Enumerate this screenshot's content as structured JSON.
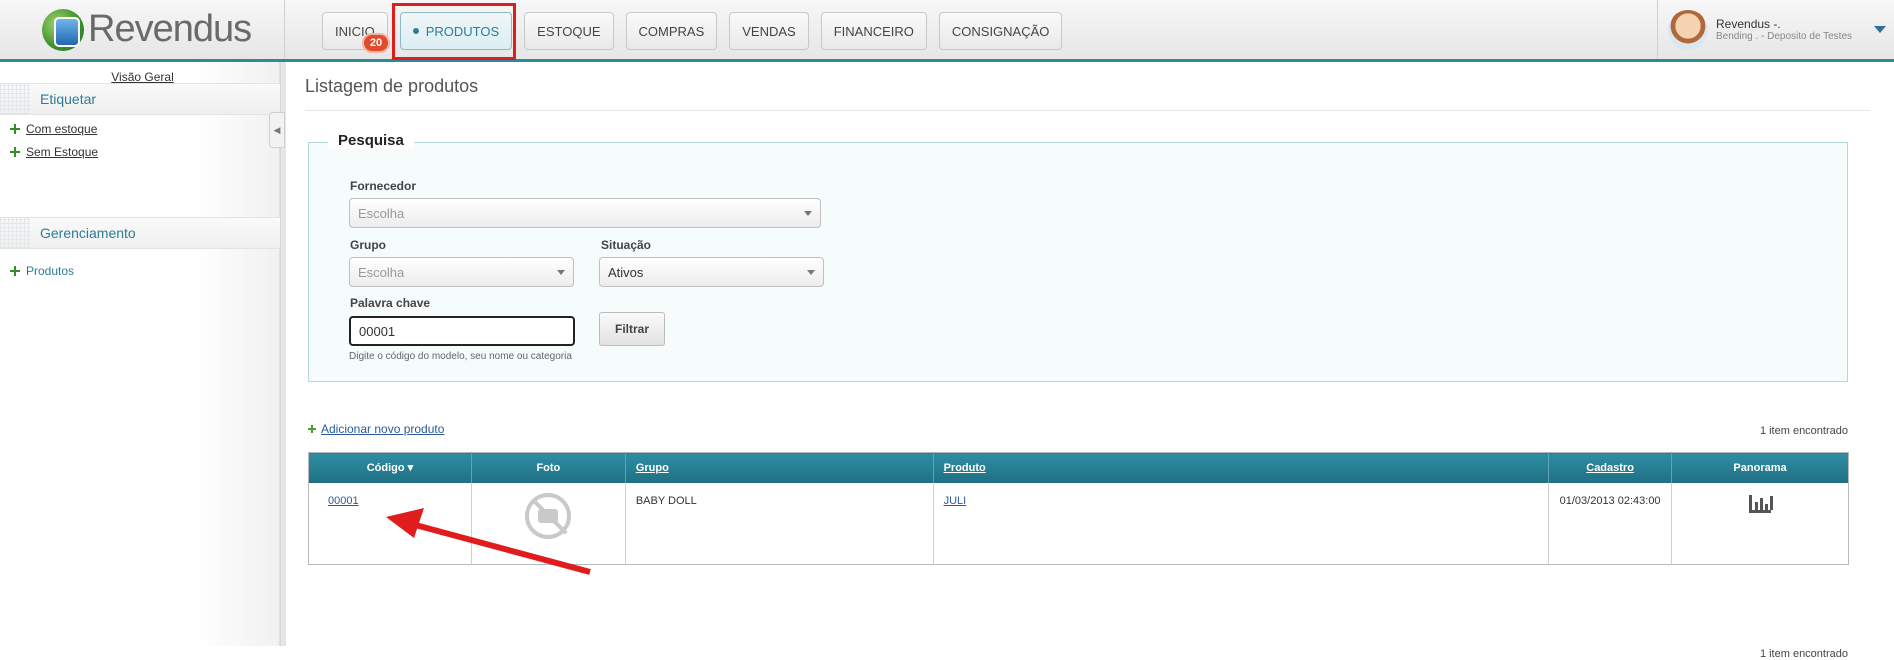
{
  "app": {
    "brand": "Revendus",
    "accent": "#2b7e95",
    "highlight": "#e11c1c"
  },
  "nav": {
    "items": [
      {
        "label": "INICIO",
        "active": false
      },
      {
        "label": "PRODUTOS",
        "active": true
      },
      {
        "label": "ESTOQUE",
        "active": false
      },
      {
        "label": "COMPRAS",
        "active": false
      },
      {
        "label": "VENDAS",
        "active": false
      },
      {
        "label": "FINANCEIRO",
        "active": false
      },
      {
        "label": "CONSIGNAÇÃO",
        "active": false
      }
    ],
    "badge": "20"
  },
  "user": {
    "name": "Revendus -.",
    "org": "Bending . - Deposito de Testes",
    "avatar_icon": "user-avatar"
  },
  "sidebar": {
    "overview": "Visão Geral",
    "sections": [
      {
        "title": "Etiquetar",
        "links": [
          "Com estoque",
          "Sem Estoque"
        ]
      },
      {
        "title": "Gerenciamento",
        "links": [
          "Produtos"
        ]
      }
    ]
  },
  "main": {
    "title": "Listagem de produtos",
    "search": {
      "legend": "Pesquisa",
      "fornecedor_label": "Fornecedor",
      "fornecedor_value": "Escolha",
      "grupo_label": "Grupo",
      "grupo_value": "Escolha",
      "situacao_label": "Situação",
      "situacao_value": "Ativos",
      "keyword_label": "Palavra chave",
      "keyword_value": "00001",
      "filter_button": "Filtrar",
      "hint": "Digite o código do modelo, seu nome ou categoria"
    },
    "add_link": "Adicionar novo produto",
    "count_top": "1 item encontrado",
    "count_bottom": "1 item encontrado",
    "table": {
      "headers": [
        "Código",
        "Foto",
        "Grupo",
        "Produto",
        "Cadastro",
        "Panorama"
      ],
      "rows": [
        {
          "codigo": "00001",
          "foto_icon": "no-photo-icon",
          "grupo": "BABY DOLL",
          "produto": "JULI",
          "cadastro": "01/03/2013 02:43:00",
          "panorama_icon": "bar-chart-icon"
        }
      ]
    }
  }
}
